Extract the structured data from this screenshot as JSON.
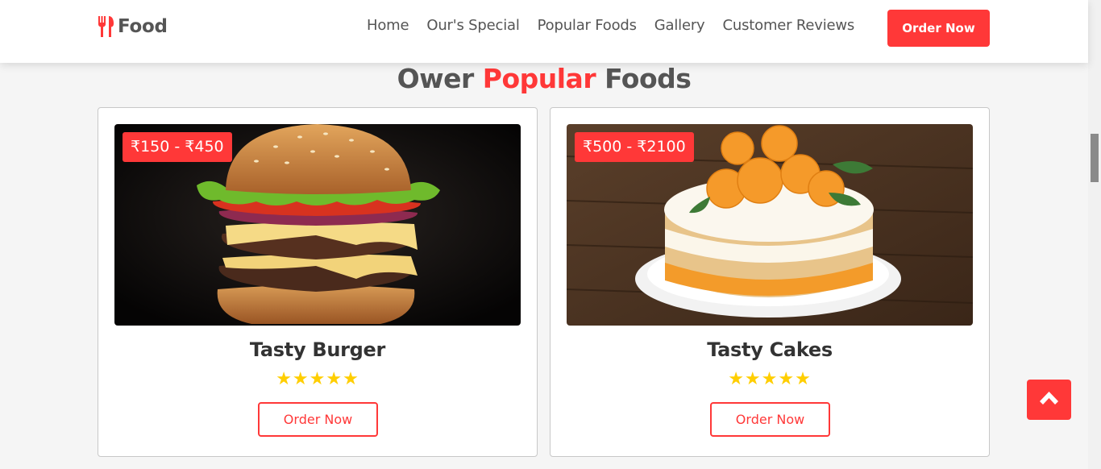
{
  "header": {
    "logo_text": "Food",
    "logo_icon": "utensils-icon",
    "nav": [
      "Home",
      "Our's Special",
      "Popular Foods",
      "Gallery",
      "Customer Reviews"
    ],
    "cta_label": "Order Now"
  },
  "section": {
    "title_part1": "Ower ",
    "title_accent": "Popular",
    "title_part2": " Foods"
  },
  "cards": [
    {
      "price": "₹150 - ₹450",
      "title": "Tasty Burger",
      "stars": "★★★★★",
      "rating": 5,
      "button": "Order Now"
    },
    {
      "price": "₹500 - ₹2100",
      "title": "Tasty Cakes",
      "stars": "★★★★★",
      "rating": 5,
      "button": "Order Now"
    }
  ],
  "scroll_top_icon": "chevron-up-icon",
  "colors": {
    "accent": "#ff3838",
    "star": "#ffce00",
    "text": "#555555"
  }
}
